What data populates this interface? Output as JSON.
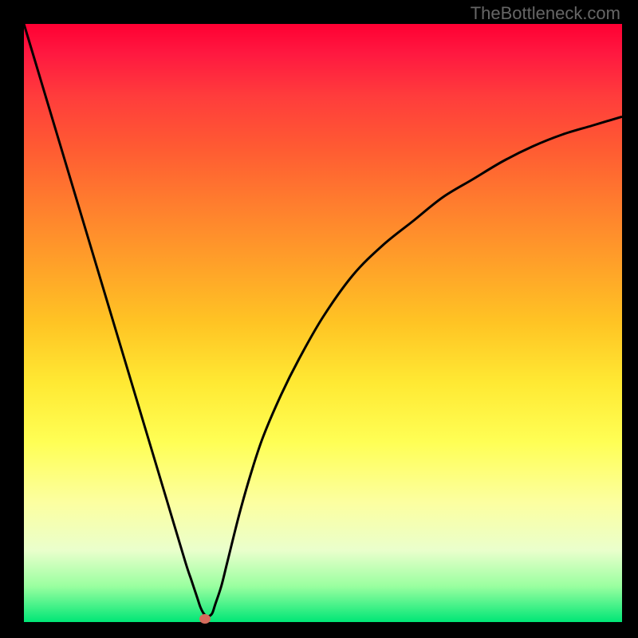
{
  "watermark": "TheBottleneck.com",
  "chart_data": {
    "type": "line",
    "title": "",
    "xlabel": "",
    "ylabel": "",
    "xlim": [
      0,
      100
    ],
    "ylim": [
      0,
      100
    ],
    "x": [
      0,
      3,
      6,
      9,
      12,
      15,
      18,
      21,
      24,
      27,
      28,
      29,
      29.5,
      30,
      30.5,
      31,
      31.5,
      32,
      33,
      34,
      36,
      38,
      40,
      43,
      46,
      50,
      55,
      60,
      65,
      70,
      75,
      80,
      85,
      90,
      95,
      100
    ],
    "y": [
      100,
      90,
      80,
      70,
      60,
      50,
      40,
      30,
      20,
      10,
      7,
      4,
      2.5,
      1.5,
      1.0,
      1.0,
      1.5,
      3,
      6,
      10,
      18,
      25,
      31,
      38,
      44,
      51,
      58,
      63,
      67,
      71,
      74,
      77,
      79.5,
      81.5,
      83,
      84.5
    ],
    "marker": {
      "x": 30.2,
      "y": 0.5
    }
  },
  "colors": {
    "curve": "#000000",
    "marker": "#d66b5c",
    "background_frame": "#000000"
  }
}
